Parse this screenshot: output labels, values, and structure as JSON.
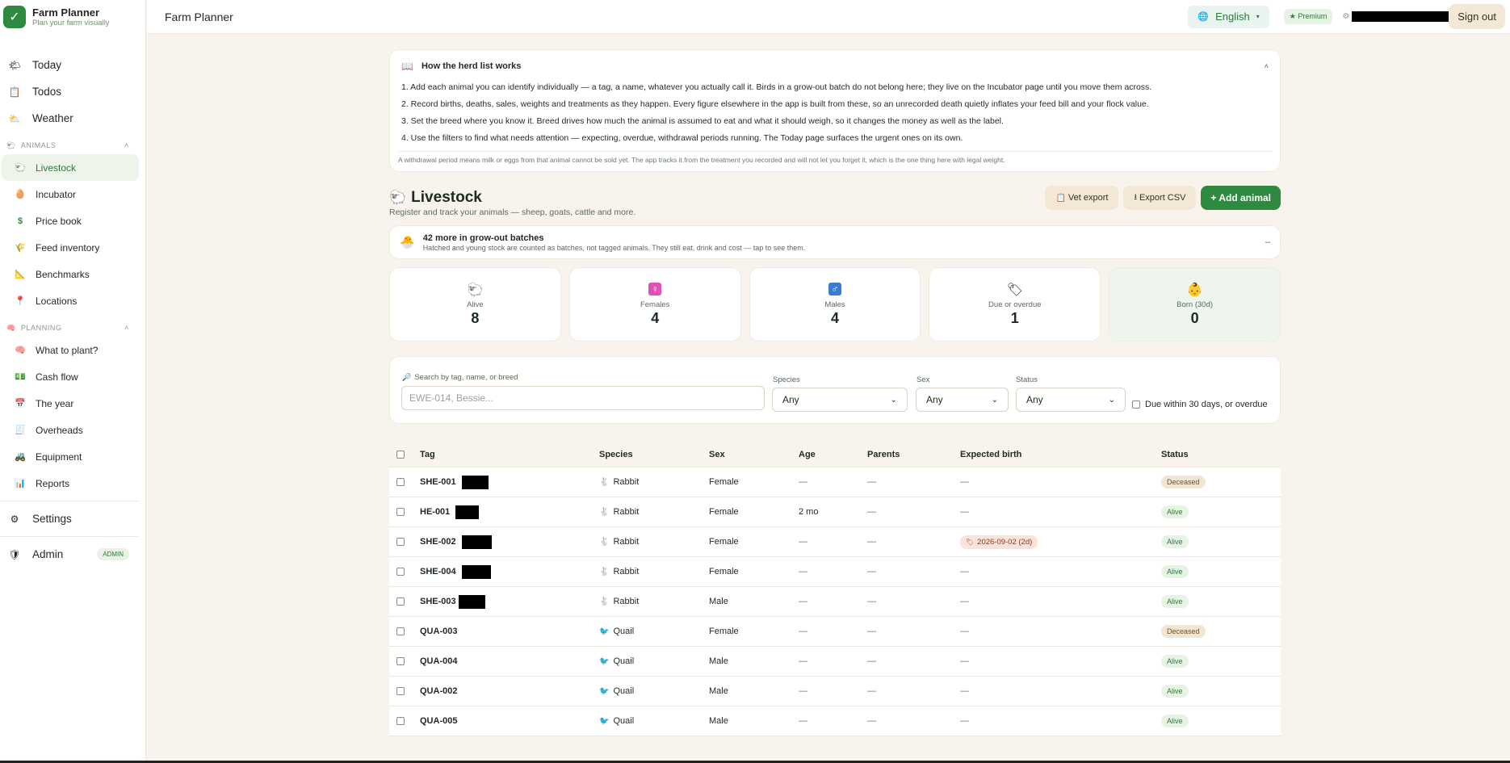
{
  "brand": {
    "title": "Farm Planner",
    "subtitle": "Plan your farm visually"
  },
  "nav_top": [
    {
      "label": "Today",
      "icon": "sun-icon"
    },
    {
      "label": "Todos",
      "icon": "checklist-icon"
    },
    {
      "label": "Weather",
      "icon": "cloud-icon"
    }
  ],
  "sections": {
    "animals": {
      "label": "ANIMALS",
      "items": [
        {
          "label": "Livestock",
          "icon": "sheep-icon"
        },
        {
          "label": "Incubator",
          "icon": "egg-icon"
        },
        {
          "label": "Price book",
          "icon": "dollar-icon"
        },
        {
          "label": "Feed inventory",
          "icon": "grain-icon"
        },
        {
          "label": "Benchmarks",
          "icon": "triangle-ruler-icon"
        },
        {
          "label": "Locations",
          "icon": "pin-icon"
        }
      ]
    },
    "planning": {
      "label": "PLANNING",
      "items": [
        {
          "label": "What to plant?",
          "icon": "brain-icon"
        },
        {
          "label": "Cash flow",
          "icon": "cash-icon"
        },
        {
          "label": "The year",
          "icon": "calendar-icon"
        },
        {
          "label": "Overheads",
          "icon": "receipt-icon"
        },
        {
          "label": "Equipment",
          "icon": "tractor-icon"
        },
        {
          "label": "Reports",
          "icon": "bar-chart-icon"
        }
      ]
    }
  },
  "nav_bottom": {
    "settings": "Settings",
    "admin": "Admin",
    "admin_badge": "ADMIN"
  },
  "topbar": {
    "title": "Farm Planner",
    "language": "English",
    "premium": "★ Premium",
    "sign_out": "Sign out"
  },
  "howto": {
    "title": "How the herd list works",
    "collapse": "˄",
    "items": [
      "1. Add each animal you can identify individually — a tag, a name, whatever you actually call it. Birds in a grow-out batch do not belong here; they live on the Incubator page until you move them across.",
      "2. Record births, deaths, sales, weights and treatments as they happen. Every figure elsewhere in the app is built from these, so an unrecorded death quietly inflates your feed bill and your flock value.",
      "3. Set the breed where you know it. Breed drives how much the animal is assumed to eat and what it should weigh, so it changes the money as well as the label.",
      "4. Use the filters to find what needs attention — expecting, overdue, withdrawal periods running. The Today page surfaces the urgent ones on its own."
    ],
    "note": "A withdrawal period means milk or eggs from that animal cannot be sold yet. The app tracks it from the treatment you recorded and will not let you forget it, which is the one thing here with legal weight."
  },
  "page": {
    "title": "Livestock",
    "subtitle": "Register and track your animals — sheep, goats, cattle and more.",
    "vet_export": "Vet export",
    "export_csv": "Export CSV",
    "add_animal": "+ Add animal"
  },
  "batches": {
    "title": "42 more in grow-out batches",
    "subtitle": "Hatched and young stock are counted as batches, not tagged animals. They still eat, drink and cost — tap to see them.",
    "toggle": "–"
  },
  "stats": [
    {
      "label": "Alive",
      "value": "8"
    },
    {
      "label": "Females",
      "value": "4"
    },
    {
      "label": "Males",
      "value": "4"
    },
    {
      "label": "Due or overdue",
      "value": "1"
    },
    {
      "label": "Born (30d)",
      "value": "0"
    }
  ],
  "filters": {
    "search_label": "Search by tag, name, or breed",
    "search_placeholder": "EWE-014, Bessie...",
    "species_label": "Species",
    "species_value": "Any",
    "sex_label": "Sex",
    "sex_value": "Any",
    "status_label": "Status",
    "status_value": "Any",
    "due_label": "Due within 30 days, or overdue"
  },
  "table": {
    "columns": {
      "tag": "Tag",
      "species": "Species",
      "sex": "Sex",
      "age": "Age",
      "parents": "Parents",
      "expected": "Expected birth",
      "status": "Status"
    },
    "rows": [
      {
        "tag": "SHE-001",
        "species": "Rabbit",
        "sex": "Female",
        "age": "—",
        "parents": "—",
        "expected": "—",
        "status": "Deceased"
      },
      {
        "tag": "HE-001",
        "species": "Rabbit",
        "sex": "Female",
        "age": "2 mo",
        "parents": "—",
        "expected": "—",
        "status": "Alive"
      },
      {
        "tag": "SHE-002",
        "species": "Rabbit",
        "sex": "Female",
        "age": "—",
        "parents": "—",
        "expected": "2026-09-02 (2d)",
        "status": "Alive"
      },
      {
        "tag": "SHE-004",
        "species": "Rabbit",
        "sex": "Female",
        "age": "—",
        "parents": "—",
        "expected": "—",
        "status": "Alive"
      },
      {
        "tag": "SHE-003",
        "species": "Rabbit",
        "sex": "Male",
        "age": "—",
        "parents": "—",
        "expected": "—",
        "status": "Alive"
      },
      {
        "tag": "QUA-003",
        "species": "Quail",
        "sex": "Female",
        "age": "—",
        "parents": "—",
        "expected": "—",
        "status": "Deceased"
      },
      {
        "tag": "QUA-004",
        "species": "Quail",
        "sex": "Male",
        "age": "—",
        "parents": "—",
        "expected": "—",
        "status": "Alive"
      },
      {
        "tag": "QUA-002",
        "species": "Quail",
        "sex": "Male",
        "age": "—",
        "parents": "—",
        "expected": "—",
        "status": "Alive"
      },
      {
        "tag": "QUA-005",
        "species": "Quail",
        "sex": "Male",
        "age": "—",
        "parents": "—",
        "expected": "—",
        "status": "Alive"
      }
    ]
  },
  "colors": {
    "primary": "#2e8a3e",
    "background": "#f8f4ed",
    "accent_soft": "#f3e8d6"
  }
}
